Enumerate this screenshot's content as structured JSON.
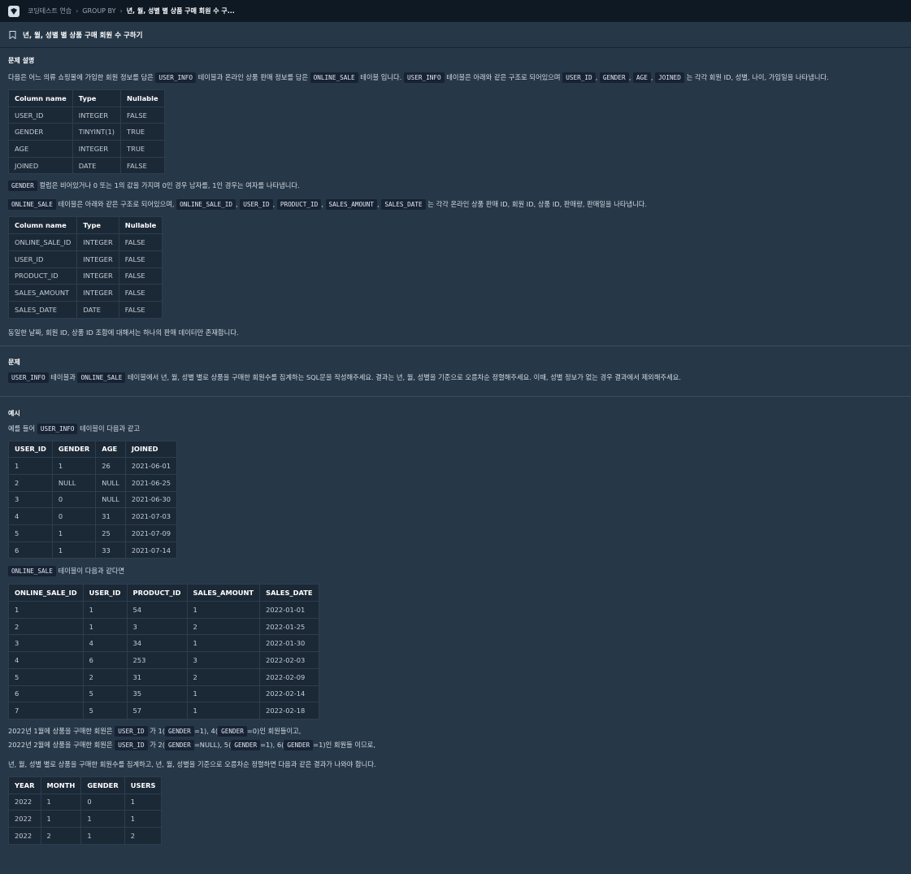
{
  "breadcrumb": [
    "코딩테스트 연습",
    "GROUP BY",
    "년, 월, 성별 별 상품 구매 회원 수 구..."
  ],
  "title": "년, 월, 성별 별 상품 구매 회원 수 구하기",
  "section_desc": "문제 설명",
  "intro": {
    "t1": "다음은 어느 의류 쇼핑몰에 가입한 회원 정보를 담은",
    "c1": "USER_INFO",
    "t2": "테이블과 온라인 상품 판매 정보를 담은",
    "c2": "ONLINE_SALE",
    "t3": "테이블 입니다.",
    "c3": "USER_INFO",
    "t4": "테이블은 아래와 같은 구조로 되어있으며",
    "c4": "USER_ID",
    "c5": "GENDER",
    "c6": "AGE",
    "c7": "JOINED",
    "t5": "는 각각 회원 ID, 성별, 나이, 가입일을 나타냅니다."
  },
  "schema_user": {
    "headers": [
      "Column name",
      "Type",
      "Nullable"
    ],
    "rows": [
      [
        "USER_ID",
        "INTEGER",
        "FALSE"
      ],
      [
        "GENDER",
        "TINYINT(1)",
        "TRUE"
      ],
      [
        "AGE",
        "INTEGER",
        "TRUE"
      ],
      [
        "JOINED",
        "DATE",
        "FALSE"
      ]
    ]
  },
  "gender_note": {
    "c": "GENDER",
    "t": "컬럼은 비어있거나 0 또는 1의 값을 가지며 0인 경우 남자를, 1인 경우는 여자를 나타냅니다."
  },
  "sale_intro": {
    "c1": "ONLINE_SALE",
    "t1": "테이블은 아래와 같은 구조로 되어있으며,",
    "c2": "ONLINE_SALE_ID",
    "c3": "USER_ID",
    "c4": "PRODUCT_ID",
    "c5": "SALES_AMOUNT",
    "c6": "SALES_DATE",
    "t2": "는 각각 온라인 상품 판매 ID, 회원 ID, 상품 ID, 판매량, 판매일을 나타냅니다."
  },
  "schema_sale": {
    "headers": [
      "Column name",
      "Type",
      "Nullable"
    ],
    "rows": [
      [
        "ONLINE_SALE_ID",
        "INTEGER",
        "FALSE"
      ],
      [
        "USER_ID",
        "INTEGER",
        "FALSE"
      ],
      [
        "PRODUCT_ID",
        "INTEGER",
        "FALSE"
      ],
      [
        "SALES_AMOUNT",
        "INTEGER",
        "FALSE"
      ],
      [
        "SALES_DATE",
        "DATE",
        "FALSE"
      ]
    ]
  },
  "unique_note": "동일한 날짜, 회원 ID, 상품 ID 조합에 대해서는 하나의 판매 데이터만 존재합니다.",
  "section_problem": "문제",
  "problem": {
    "c1": "USER_INFO",
    "t1": "테이블과",
    "c2": "ONLINE_SALE",
    "t2": "테이블에서 년, 월, 성별 별로 상품을 구매한 회원수를 집계하는 SQL문을 작성해주세요. 결과는 년, 월, 성별을 기준으로 오름차순 정렬해주세요. 이때, 성별 정보가 없는 경우 결과에서 제외해주세요."
  },
  "section_example": "예시",
  "ex1": {
    "t1": "예를 들어",
    "c": "USER_INFO",
    "t2": "테이블이 다음과 같고"
  },
  "user_table": {
    "headers": [
      "USER_ID",
      "GENDER",
      "AGE",
      "JOINED"
    ],
    "rows": [
      [
        "1",
        "1",
        "26",
        "2021-06-01"
      ],
      [
        "2",
        "NULL",
        "NULL",
        "2021-06-25"
      ],
      [
        "3",
        "0",
        "NULL",
        "2021-06-30"
      ],
      [
        "4",
        "0",
        "31",
        "2021-07-03"
      ],
      [
        "5",
        "1",
        "25",
        "2021-07-09"
      ],
      [
        "6",
        "1",
        "33",
        "2021-07-14"
      ]
    ]
  },
  "ex2": {
    "c": "ONLINE_SALE",
    "t": "테이블이 다음과 같다면"
  },
  "sale_table": {
    "headers": [
      "ONLINE_SALE_ID",
      "USER_ID",
      "PRODUCT_ID",
      "SALES_AMOUNT",
      "SALES_DATE"
    ],
    "rows": [
      [
        "1",
        "1",
        "54",
        "1",
        "2022-01-01"
      ],
      [
        "2",
        "1",
        "3",
        "2",
        "2022-01-25"
      ],
      [
        "3",
        "4",
        "34",
        "1",
        "2022-01-30"
      ],
      [
        "4",
        "6",
        "253",
        "3",
        "2022-02-03"
      ],
      [
        "5",
        "2",
        "31",
        "2",
        "2022-02-09"
      ],
      [
        "6",
        "5",
        "35",
        "1",
        "2022-02-14"
      ],
      [
        "7",
        "5",
        "57",
        "1",
        "2022-02-18"
      ]
    ]
  },
  "jan": {
    "t1": "2022년 1월에 상품을 구매한 회원은",
    "c1": "USER_ID",
    "t2": "가 1(",
    "c2": "GENDER",
    "t3": "=1), 4(",
    "c3": "GENDER",
    "t4": "=0)인 회원들이고,"
  },
  "feb": {
    "t1": "2022년 2월에 상품을 구매한 회원은",
    "c1": "USER_ID",
    "t2": "가 2(",
    "c2": "GENDER",
    "t3": "=NULL), 5(",
    "c3": "GENDER",
    "t4": "=1), 6(",
    "c4": "GENDER",
    "t5": "=1)인 회원들 이므로,"
  },
  "result_note": "년, 월, 성별 별로 상품을 구매한 회원수를 집계하고, 년, 월, 성별을 기준으로 오름차순 정렬하면 다음과 같은 결과가 나와야 합니다.",
  "result_table": {
    "headers": [
      "YEAR",
      "MONTH",
      "GENDER",
      "USERS"
    ],
    "rows": [
      [
        "2022",
        "1",
        "0",
        "1"
      ],
      [
        "2022",
        "1",
        "1",
        "1"
      ],
      [
        "2022",
        "2",
        "1",
        "2"
      ]
    ]
  }
}
